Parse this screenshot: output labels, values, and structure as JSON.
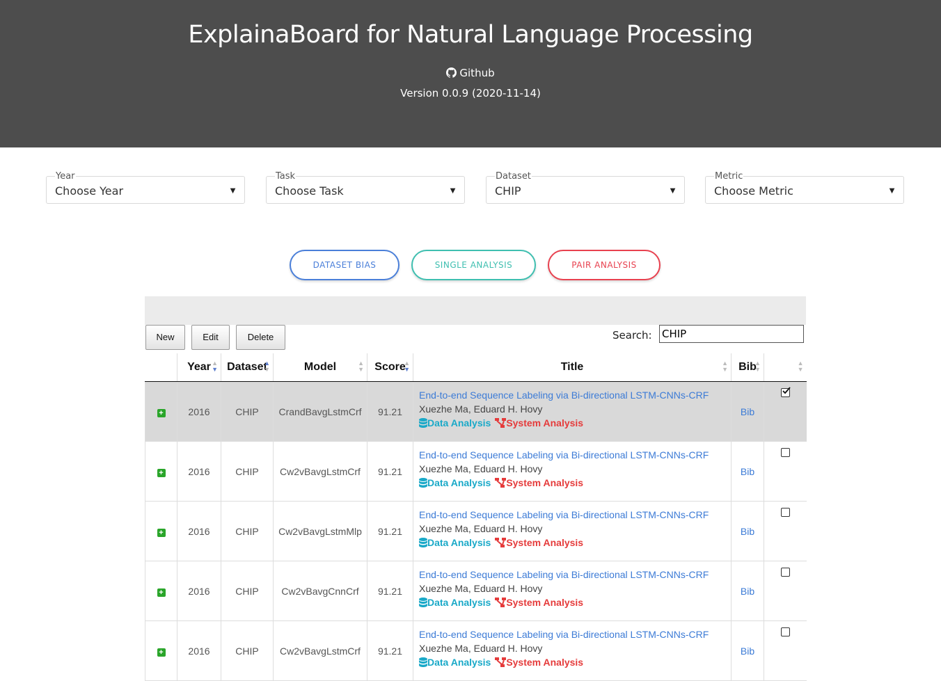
{
  "header": {
    "title": "ExplainaBoard for Natural Language Processing",
    "github_label": "Github",
    "version": "Version 0.0.9 (2020-11-14)"
  },
  "filters": [
    {
      "label": "Year",
      "value": "Choose Year"
    },
    {
      "label": "Task",
      "value": "Choose Task"
    },
    {
      "label": "Dataset",
      "value": "CHIP"
    },
    {
      "label": "Metric",
      "value": "Choose Metric"
    }
  ],
  "analysis_buttons": {
    "dataset_bias": "DATASET BIAS",
    "single": "SINGLE ANALYSIS",
    "pair": "PAIR ANALYSIS"
  },
  "colors": {
    "dataset_bias": "#4a7fd9",
    "single": "#3fbfb0",
    "pair": "#e8414f",
    "header_bg": "#4d4d4d"
  },
  "toolbar": {
    "new": "New",
    "edit": "Edit",
    "delete": "Delete",
    "search_label": "Search:",
    "search_value": "CHIP"
  },
  "table": {
    "columns": [
      "",
      "Year",
      "Dataset",
      "Model",
      "Score",
      "Title",
      "Bib",
      ""
    ],
    "rows": [
      {
        "year": "2016",
        "dataset": "CHIP",
        "model": "CrandBavgLstmCrf",
        "score": "91.21",
        "title": "End-to-end Sequence Labeling via Bi-directional LSTM-CNNs-CRF",
        "authors": "Xuezhe Ma, Eduard H. Hovy",
        "data_analysis": "Data Analysis",
        "system_analysis": "System Analysis",
        "bib": "Bib",
        "checked": true
      },
      {
        "year": "2016",
        "dataset": "CHIP",
        "model": "Cw2vBavgLstmCrf",
        "score": "91.21",
        "title": "End-to-end Sequence Labeling via Bi-directional LSTM-CNNs-CRF",
        "authors": "Xuezhe Ma, Eduard H. Hovy",
        "data_analysis": "Data Analysis",
        "system_analysis": "System Analysis",
        "bib": "Bib",
        "checked": false
      },
      {
        "year": "2016",
        "dataset": "CHIP",
        "model": "Cw2vBavgLstmMlp",
        "score": "91.21",
        "title": "End-to-end Sequence Labeling via Bi-directional LSTM-CNNs-CRF",
        "authors": "Xuezhe Ma, Eduard H. Hovy",
        "data_analysis": "Data Analysis",
        "system_analysis": "System Analysis",
        "bib": "Bib",
        "checked": false
      },
      {
        "year": "2016",
        "dataset": "CHIP",
        "model": "Cw2vBavgCnnCrf",
        "score": "91.21",
        "title": "End-to-end Sequence Labeling via Bi-directional LSTM-CNNs-CRF",
        "authors": "Xuezhe Ma, Eduard H. Hovy",
        "data_analysis": "Data Analysis",
        "system_analysis": "System Analysis",
        "bib": "Bib",
        "checked": false
      },
      {
        "year": "2016",
        "dataset": "CHIP",
        "model": "Cw2vBavgLstmCrf",
        "score": "91.21",
        "title": "End-to-end Sequence Labeling via Bi-directional LSTM-CNNs-CRF",
        "authors": "Xuezhe Ma, Eduard H. Hovy",
        "data_analysis": "Data Analysis",
        "system_analysis": "System Analysis",
        "bib": "Bib",
        "checked": false
      }
    ]
  }
}
